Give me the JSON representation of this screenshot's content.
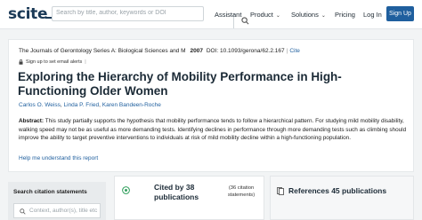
{
  "header": {
    "logo": "scite",
    "search_placeholder": "Search by title, author, keywords or DOI",
    "nav": {
      "assistant": "Assistant",
      "product": "Product",
      "solutions": "Solutions",
      "pricing": "Pricing",
      "login": "Log In",
      "signup": "Sign Up"
    }
  },
  "paper": {
    "journal": "The Journals of Gerontology Series A: Biological Sciences and M",
    "year": "2007",
    "doi": "DOI: 10.1093/gerona/62.2.167",
    "cite_label": "Cite",
    "sign_up_alerts": "Sign up to set email alerts",
    "title": "Exploring the Hierarchy of Mobility Performance in High-Functioning Older Women",
    "authors": [
      "Carlos O. Weiss",
      "Linda P. Fried",
      "Karen Bandeen-Roche"
    ],
    "abstract_label": "Abstract:",
    "abstract_text": "This study partially supports the hypothesis that mobility performance tends to follow a hierarchical pattern. For studying mild mobility disability, walking speed may not be as useful as more demanding tests. Identifying declines in performance through more demanding tests such as climbing should improve the ability to target preventive interventions to individuals at risk of mild mobility decline within a high-functioning population.",
    "help_link": "Help me understand this report"
  },
  "sidebar": {
    "search_label": "Search citation statements",
    "search_placeholder": "Context, author(s), title etc"
  },
  "cited_by": {
    "title": "Cited by 38 publications",
    "sub": "(36 citation statements)"
  },
  "references": {
    "title": "References 45 publications"
  },
  "colors": {
    "brand": "#1b3a57",
    "link": "#1f5f9e",
    "accent_green": "#2e9e5b"
  }
}
